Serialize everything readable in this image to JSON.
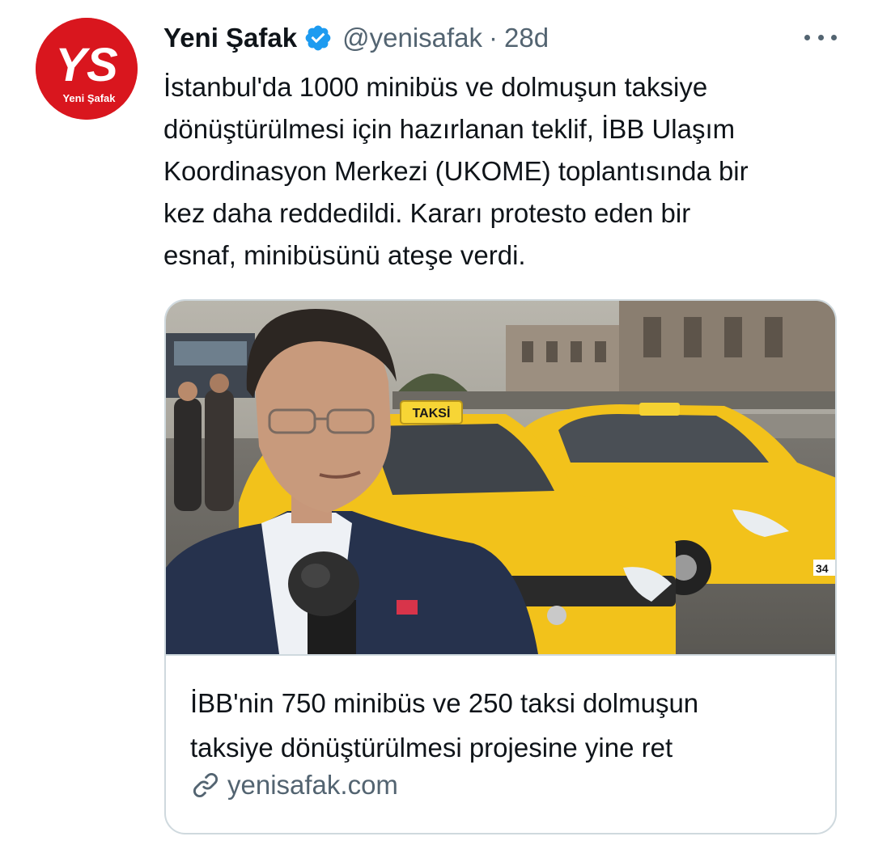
{
  "tweet": {
    "author": {
      "name": "Yeni Şafak",
      "handle": "@yenisafak",
      "avatar_letters": "YS",
      "avatar_caption": "Yeni Şafak",
      "verified": true
    },
    "separator": "·",
    "timestamp": "28d",
    "text_lines": [
      "İstanbul'da 1000 minibüs ve dolmuşun taksiye",
      "dönüştürülmesi için hazırlanan teklif, İBB Ulaşım",
      "Koordinasyon Merkezi (UKOME) toplantısında bir",
      "kez daha reddedildi. Kararı protesto eden bir",
      "esnaf, minibüsünü ateşe verdi."
    ],
    "card": {
      "taxi_sign_text": "TAKSİ",
      "plate_text": "34",
      "title_lines": [
        "İBB'nin 750 minibüs ve 250 taksi dolmuşun",
        "taksiye dönüştürülmesi projesine yine ret"
      ],
      "domain": "yenisafak.com"
    }
  },
  "colors": {
    "text_primary": "#0f1419",
    "text_secondary": "#536471",
    "verified_blue": "#1d9bf0",
    "brand_red": "#d9161e",
    "taxi_yellow": "#f2c21b",
    "border": "#cfd9de"
  },
  "icons": {
    "verified": "verified-badge-icon",
    "more": "more-horizontal-icon",
    "link": "link-icon"
  }
}
